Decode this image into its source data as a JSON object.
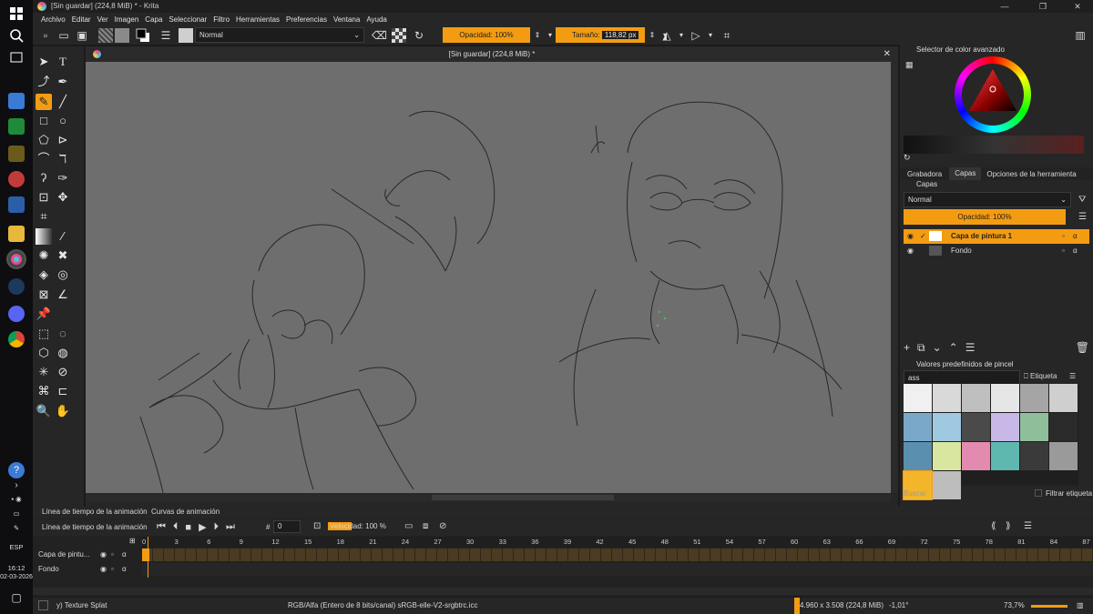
{
  "window": {
    "title": "[Sin guardar]  (224,8 MiB) * - Krita"
  },
  "menu": [
    "Archivo",
    "Editar",
    "Ver",
    "Imagen",
    "Capa",
    "Seleccionar",
    "Filtro",
    "Herramientas",
    "Preferencias",
    "Ventana",
    "Ayuda"
  ],
  "toolbar": {
    "blend_mode": "Normal",
    "opacity": "Opacidad: 100%",
    "size_label": "Tamaño:",
    "size_value": "118,82 px"
  },
  "canvas": {
    "title": "[Sin guardar]  (224,8 MiB) *"
  },
  "taskbar": {
    "lang": "ESP",
    "time": "16:12",
    "date": "02-03-2026"
  },
  "dock": {
    "color_selector_title": "Selector de color avanzado",
    "tabs": [
      "Grabadora",
      "Capas",
      "Opciones de la herramienta"
    ],
    "layers_title": "Capas",
    "layers_blend": "Normal",
    "layers_opacity": "Opacidad:  100%",
    "layers": [
      {
        "name": "Capa de pintura 1",
        "active": true
      },
      {
        "name": "Fondo",
        "active": false
      }
    ],
    "brush_presets_title": "Valores predefinidos de pincel",
    "brush_filter_value": "ass",
    "brush_tag_label": "Etiqueta",
    "brush_search_placeholder": "Buscar",
    "brush_filter_tag": "Filtrar etiqueta"
  },
  "timeline": {
    "tabs": [
      "Línea de tiempo de la animación",
      "Curvas de animación"
    ],
    "header": "Línea de tiempo de la animación",
    "frame_value": "0",
    "speed_label": "Velocidad: 100 %",
    "ruler": [
      "0",
      "3",
      "6",
      "9",
      "12",
      "15",
      "18",
      "21",
      "24",
      "27",
      "30",
      "33",
      "36",
      "39",
      "42",
      "45",
      "48",
      "51",
      "54",
      "57",
      "60",
      "63",
      "66",
      "69",
      "72",
      "75",
      "78",
      "81",
      "84",
      "87"
    ],
    "layers": [
      "Capa de pintu...",
      "Fondo"
    ]
  },
  "status": {
    "brush": "y) Texture Splat",
    "color_space": "RGB/Alfa (Entero de 8 bits/canal)  sRGB-elle-V2-srgbtrc.icc",
    "dimensions": "4.960 x 3.508 (224,8 MiB)",
    "rotation": "-1,01°",
    "zoom": "73,7%"
  },
  "colors": {
    "accent": "#f39c12",
    "canvas": "#6e6e6e",
    "panel": "#262626"
  }
}
